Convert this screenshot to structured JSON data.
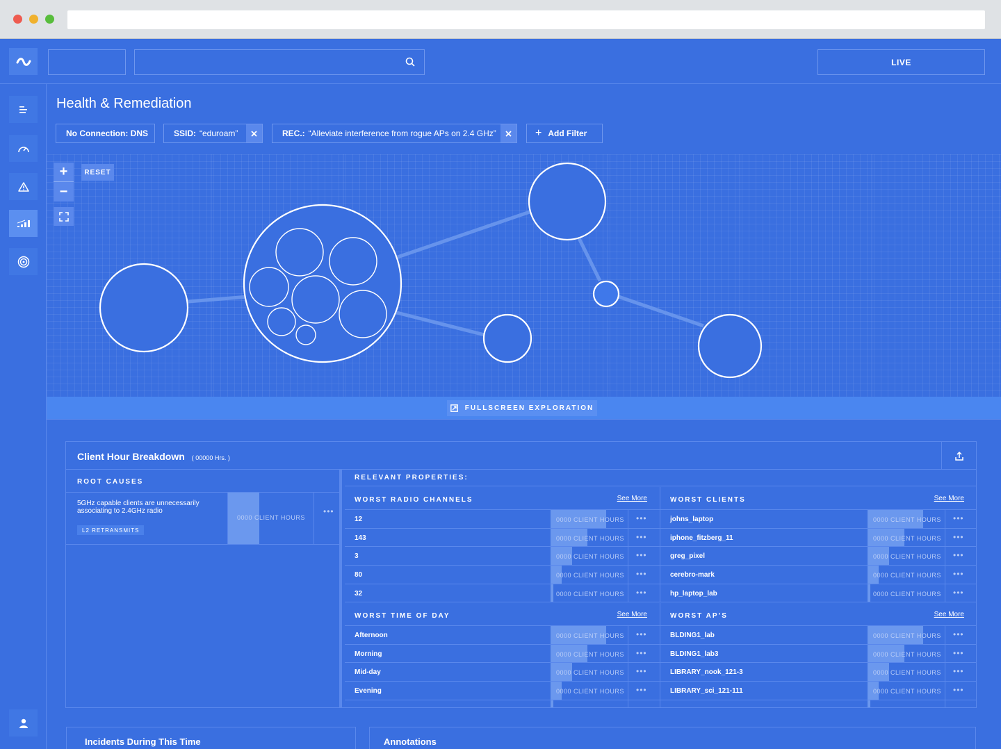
{
  "header": {
    "live_label": "LIVE"
  },
  "sidebar": {
    "items": [
      {
        "icon": "menu-icon"
      },
      {
        "icon": "speedometer-icon"
      },
      {
        "icon": "warning-icon"
      },
      {
        "icon": "chart-icon"
      },
      {
        "icon": "target-icon"
      }
    ],
    "user_icon": "user-icon"
  },
  "page": {
    "title": "Health & Remediation"
  },
  "filters": {
    "chip1": {
      "label": "No Connection: DNS"
    },
    "chip2": {
      "key": "SSID:",
      "value": "“eduroam”"
    },
    "chip3": {
      "key": "REC.:",
      "value": "“Alleviate interference from rogue APs on 2.4 GHz”"
    },
    "add_label": "Add Filter"
  },
  "graph": {
    "reset_label": "RESET",
    "zoom_in": "+",
    "zoom_out": "−"
  },
  "fullscreen": {
    "label": "FULLSCREEN EXPLORATION"
  },
  "breakdown": {
    "title": "Client Hour Breakdown",
    "subtitle": "( 00000 Hrs. )",
    "root_causes": {
      "heading": "ROOT CAUSES",
      "item": {
        "text": "5GHz capable clients are unnecessarily associating to 2.4GHz radio",
        "tag": "L2 RETRANSMITS",
        "bar_label": "0000 CLIENT HOURS",
        "fill": 0.36
      }
    },
    "relevant_heading": "RELEVANT PROPERTIES:",
    "see_more": "See More",
    "bar_label": "0000 CLIENT HOURS",
    "more": "•••",
    "radio_channels": {
      "title": "WORST RADIO CHANNELS",
      "rows": [
        {
          "name": "12",
          "fill": 0.72
        },
        {
          "name": "143",
          "fill": 0.48
        },
        {
          "name": "3",
          "fill": 0.28
        },
        {
          "name": "80",
          "fill": 0.14
        },
        {
          "name": "32",
          "fill": 0.04
        }
      ]
    },
    "clients": {
      "title": "WORST CLIENTS",
      "rows": [
        {
          "name": "johns_laptop",
          "fill": 0.72
        },
        {
          "name": "iphone_fitzberg_11",
          "fill": 0.48
        },
        {
          "name": "greg_pixel",
          "fill": 0.28
        },
        {
          "name": "cerebro-mark",
          "fill": 0.14
        },
        {
          "name": "hp_laptop_lab",
          "fill": 0.04
        }
      ]
    },
    "time_of_day": {
      "title": "WORST TIME OF DAY",
      "rows": [
        {
          "name": "Afternoon",
          "fill": 0.72
        },
        {
          "name": "Morning",
          "fill": 0.48
        },
        {
          "name": "Mid-day",
          "fill": 0.28
        },
        {
          "name": "Evening",
          "fill": 0.14
        },
        {
          "name": "",
          "fill": 0.04
        }
      ]
    },
    "aps": {
      "title": "WORST AP’S",
      "rows": [
        {
          "name": "BLDING1_lab",
          "fill": 0.72
        },
        {
          "name": "BLDING1_lab3",
          "fill": 0.48
        },
        {
          "name": "LIBRARY_nook_121-3",
          "fill": 0.28
        },
        {
          "name": "LIBRARY_sci_121-111",
          "fill": 0.14
        },
        {
          "name": "",
          "fill": 0.04
        }
      ]
    }
  },
  "bottom": {
    "incidents_title": "Incidents During This Time",
    "annotations_title": "Annotations"
  }
}
